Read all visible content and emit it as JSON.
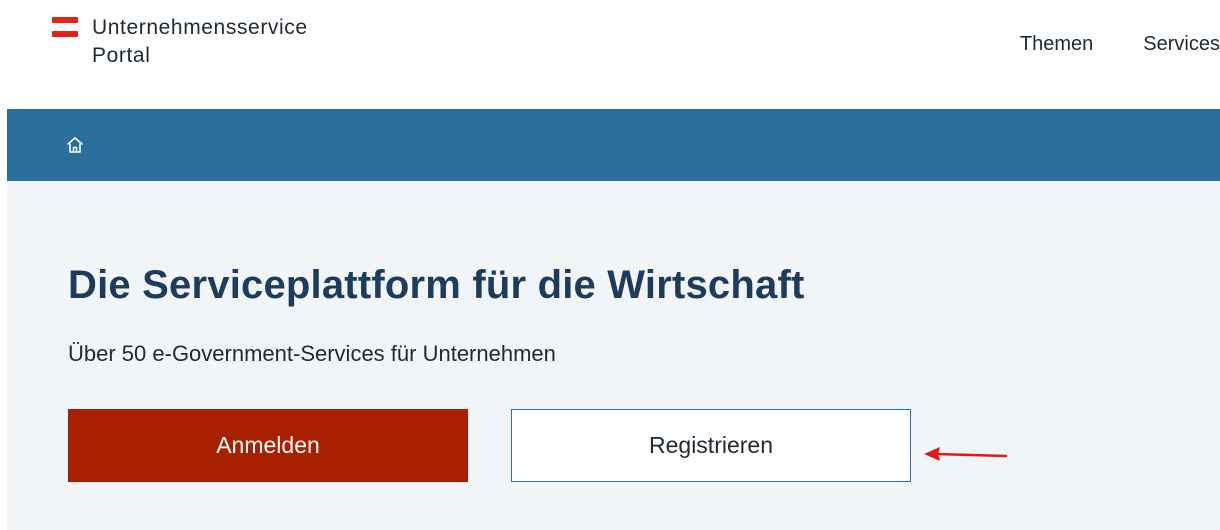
{
  "header": {
    "logo_line1": "Unternehmensservice",
    "logo_line2": "Portal",
    "nav": [
      {
        "label": "Themen"
      },
      {
        "label": "Services"
      }
    ]
  },
  "breadcrumb": {
    "home_icon": "home-icon"
  },
  "hero": {
    "title": "Die Serviceplattform für die Wirtschaft",
    "subtitle": "Über 50 e-Government-Services für Unternehmen",
    "login_label": "Anmelden",
    "register_label": "Registrieren"
  },
  "annotation": {
    "arrow_icon": "red-arrow-pointing-left",
    "arrow_color": "#e0191b"
  },
  "colors": {
    "brand_blue": "#2a6f9b",
    "login_red": "#a72100",
    "flag_red": "#e2231a",
    "hero_bg": "#f2f5f8",
    "title_color": "#1d3b5a"
  }
}
